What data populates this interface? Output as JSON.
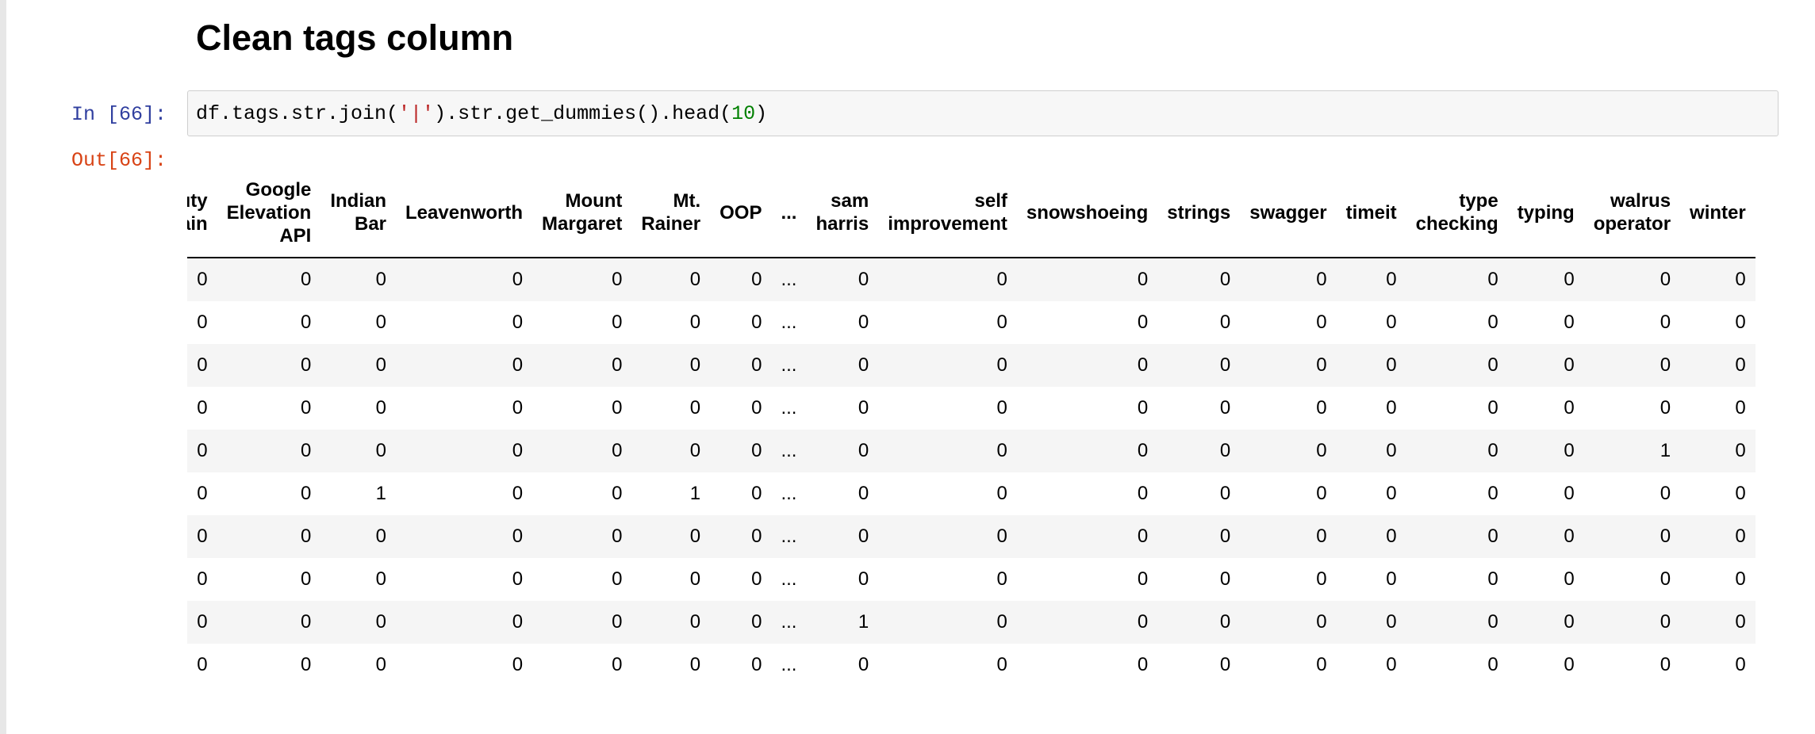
{
  "heading": "Clean tags column",
  "cell": {
    "in_prompt": "In [66]:",
    "out_prompt": "Out[66]:",
    "code": {
      "part1": "df.tags.str.join(",
      "str_literal": "'|'",
      "part2": ").str.get_dummies().head(",
      "num_literal": "10",
      "part3": ")"
    }
  },
  "table": {
    "columns": [
      [
        "Beauty",
        "Mountain"
      ],
      [
        "Google",
        "Elevation",
        "API"
      ],
      [
        "Indian",
        "Bar"
      ],
      [
        "Leavenworth"
      ],
      [
        "Mount",
        "Margaret"
      ],
      [
        "Mt.",
        "Rainer"
      ],
      [
        "OOP"
      ],
      [
        "..."
      ],
      [
        "sam",
        "harris"
      ],
      [
        "self",
        "improvement"
      ],
      [
        "snowshoeing"
      ],
      [
        "strings"
      ],
      [
        "swagger"
      ],
      [
        "timeit"
      ],
      [
        "type",
        "checking"
      ],
      [
        "typing"
      ],
      [
        "walrus",
        "operator"
      ],
      [
        "winter"
      ]
    ],
    "rows": [
      [
        "0",
        "0",
        "0",
        "0",
        "0",
        "0",
        "0",
        "...",
        "0",
        "0",
        "0",
        "0",
        "0",
        "0",
        "0",
        "0",
        "0",
        "0"
      ],
      [
        "0",
        "0",
        "0",
        "0",
        "0",
        "0",
        "0",
        "...",
        "0",
        "0",
        "0",
        "0",
        "0",
        "0",
        "0",
        "0",
        "0",
        "0"
      ],
      [
        "0",
        "0",
        "0",
        "0",
        "0",
        "0",
        "0",
        "...",
        "0",
        "0",
        "0",
        "0",
        "0",
        "0",
        "0",
        "0",
        "0",
        "0"
      ],
      [
        "0",
        "0",
        "0",
        "0",
        "0",
        "0",
        "0",
        "...",
        "0",
        "0",
        "0",
        "0",
        "0",
        "0",
        "0",
        "0",
        "0",
        "0"
      ],
      [
        "0",
        "0",
        "0",
        "0",
        "0",
        "0",
        "0",
        "...",
        "0",
        "0",
        "0",
        "0",
        "0",
        "0",
        "0",
        "0",
        "1",
        "0"
      ],
      [
        "0",
        "0",
        "1",
        "0",
        "0",
        "1",
        "0",
        "...",
        "0",
        "0",
        "0",
        "0",
        "0",
        "0",
        "0",
        "0",
        "0",
        "0"
      ],
      [
        "0",
        "0",
        "0",
        "0",
        "0",
        "0",
        "0",
        "...",
        "0",
        "0",
        "0",
        "0",
        "0",
        "0",
        "0",
        "0",
        "0",
        "0"
      ],
      [
        "0",
        "0",
        "0",
        "0",
        "0",
        "0",
        "0",
        "...",
        "0",
        "0",
        "0",
        "0",
        "0",
        "0",
        "0",
        "0",
        "0",
        "0"
      ],
      [
        "0",
        "0",
        "0",
        "0",
        "0",
        "0",
        "0",
        "...",
        "1",
        "0",
        "0",
        "0",
        "0",
        "0",
        "0",
        "0",
        "0",
        "0"
      ],
      [
        "0",
        "0",
        "0",
        "0",
        "0",
        "0",
        "0",
        "...",
        "0",
        "0",
        "0",
        "0",
        "0",
        "0",
        "0",
        "0",
        "0",
        "0"
      ]
    ]
  }
}
